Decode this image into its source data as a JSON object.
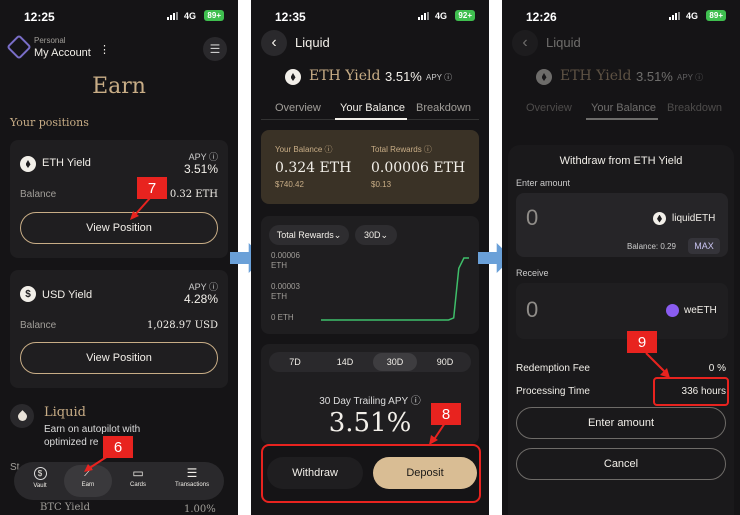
{
  "screen1": {
    "status": {
      "time": "12:25",
      "network": "4G",
      "battery": "89+"
    },
    "account": {
      "label": "Personal",
      "name": "My Account",
      "more": "⋮",
      "menu": "☰"
    },
    "title": "Earn",
    "section": "Your positions",
    "positions": [
      {
        "name": "ETH Yield",
        "apy_label": "APY ⓘ",
        "apy": "3.51%",
        "balance_label": "Balance",
        "balance": "0.32 ETH",
        "button": "View Position"
      },
      {
        "name": "USD Yield",
        "apy_label": "APY ⓘ",
        "apy": "4.28%",
        "balance_label": "Balance",
        "balance": "1,028.97 USD",
        "button": "View Position"
      }
    ],
    "liquid": {
      "title": "Liquid",
      "desc": "Earn on autopilot with optimized re",
      "partial_st": "St",
      "btc": "BTC Yield",
      "btc_val": "1.00%"
    },
    "nav": [
      {
        "label": "Vault",
        "icon": "$"
      },
      {
        "label": "Earn",
        "icon": "⟋"
      },
      {
        "label": "Cards",
        "icon": "▭"
      },
      {
        "label": "Transactions",
        "icon": "☰"
      }
    ],
    "badges": {
      "a": "7",
      "b": "6"
    }
  },
  "screen2": {
    "status": {
      "time": "12:35",
      "network": "4G",
      "battery": "92+"
    },
    "header": {
      "back": "‹",
      "title": "Liquid"
    },
    "asset": {
      "name": "ETH Yield",
      "apy": "3.51%",
      "apy_label": "APY ⓘ"
    },
    "tabs": [
      "Overview",
      "Your Balance",
      "Breakdown"
    ],
    "balance": {
      "label": "Your Balance ⓘ",
      "value": "0.324 ETH",
      "usd": "$740.42"
    },
    "rewards": {
      "label": "Total Rewards ⓘ",
      "value": "0.00006 ETH",
      "usd": "$0.13"
    },
    "chart_filters": {
      "metric": "Total Rewards",
      "period": "30D"
    },
    "chart_data": {
      "type": "line",
      "y_ticks": [
        "0.00006\nETH",
        "0.00003\nETH",
        "0 ETH"
      ],
      "ylim": [
        0,
        6e-05
      ],
      "x": [
        1,
        2,
        3,
        4,
        5,
        6,
        7,
        8,
        9,
        10,
        11,
        12,
        13,
        14,
        15,
        16,
        17,
        18,
        19,
        20,
        21,
        22,
        23,
        24,
        25,
        26,
        27,
        28,
        29,
        30
      ],
      "values": [
        0,
        0,
        0,
        0,
        0,
        0,
        0,
        0,
        0,
        0,
        0,
        0,
        0,
        0,
        0,
        0,
        0,
        0,
        0,
        0,
        0,
        0,
        0,
        0,
        0,
        0,
        2e-06,
        5e-05,
        6e-05,
        6e-05
      ]
    },
    "periods": [
      "7D",
      "14D",
      "30D",
      "90D"
    ],
    "trailing": {
      "label": "30 Day Trailing APY ⓘ",
      "value": "3.51%"
    },
    "actions": {
      "withdraw": "Withdraw",
      "deposit": "Deposit"
    },
    "badge": "8",
    "colors": {
      "deposit": "#d9bd94",
      "line": "#3fbf6a"
    }
  },
  "screen3": {
    "status": {
      "time": "12:26",
      "network": "4G",
      "battery": "89+"
    },
    "header": {
      "back": "‹",
      "title": "Liquid"
    },
    "asset": {
      "name": "ETH Yield",
      "apy": "3.51%",
      "apy_label": "APY ⓘ"
    },
    "tabs": [
      "Overview",
      "Your Balance",
      "Breakdown"
    ],
    "modal": {
      "title": "Withdraw from ETH Yield",
      "enter_label": "Enter amount",
      "amount": "0",
      "from_token": "liquidETH",
      "balance": "Balance: 0.29",
      "max": "MAX",
      "receive_label": "Receive",
      "receive_amount": "0",
      "to_token": "weETH",
      "fee_label": "Redemption Fee",
      "fee": "0 %",
      "time_label": "Processing Time",
      "time": "336 hours",
      "primary": "Enter amount",
      "cancel": "Cancel"
    },
    "badge": "9"
  }
}
